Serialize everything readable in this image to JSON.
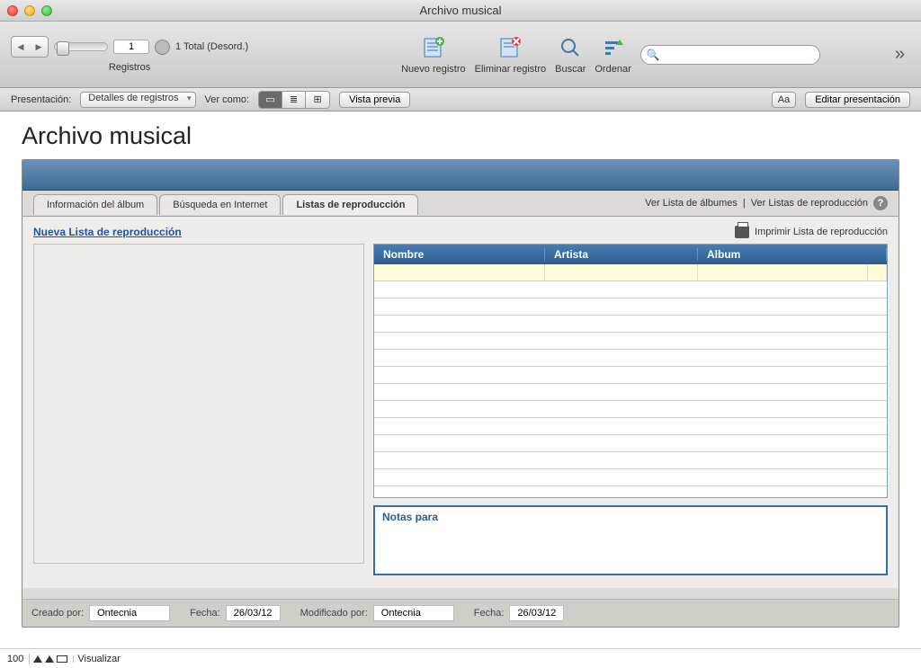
{
  "window": {
    "title": "Archivo musical"
  },
  "toolbar": {
    "record": {
      "current": "1",
      "total_line": "1\nTotal (Desord.)",
      "label": "Registros"
    },
    "buttons": {
      "new_record": "Nuevo registro",
      "delete_record": "Eliminar registro",
      "find": "Buscar",
      "sort": "Ordenar"
    },
    "search_placeholder": ""
  },
  "toolbar2": {
    "layout_label": "Presentación:",
    "layout_value": "Detalles de registros",
    "viewas_label": "Ver como:",
    "preview": "Vista previa",
    "edit_layout": "Editar presentación"
  },
  "page": {
    "title": "Archivo musical"
  },
  "tabs": [
    "Información del álbum",
    "Búsqueda en Internet",
    "Listas de reproducción"
  ],
  "panel": {
    "links": {
      "albums": "Ver Lista de álbumes",
      "playlists": "Ver Listas de reproducción"
    },
    "new_playlist": "Nueva Lista de reproducción",
    "print": "Imprimir Lista de reproducción",
    "notes_label": "Notas para"
  },
  "grid": {
    "headers": [
      "Nombre",
      "Artista",
      "Album"
    ]
  },
  "footer": {
    "created_by_label": "Creado por:",
    "created_by": "Ontecnia",
    "date_label": "Fecha:",
    "created_date": "26/03/12",
    "modified_by_label": "Modificado por:",
    "modified_by": "Ontecnia",
    "modified_date": "26/03/12"
  },
  "status": {
    "zoom": "100",
    "mode": "Visualizar"
  }
}
